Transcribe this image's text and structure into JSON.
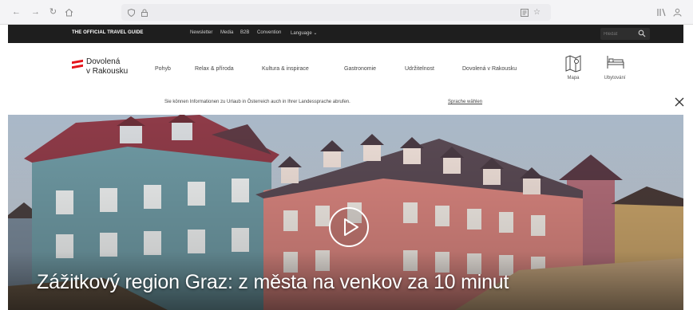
{
  "browser": {
    "back_icon": "back-arrow-icon",
    "forward_icon": "forward-arrow-icon",
    "reload_icon": "reload-icon",
    "home_icon": "home-icon",
    "url": ""
  },
  "top_bar": {
    "guide_label": "THE OFFICIAL TRAVEL GUIDE",
    "links": [
      {
        "label": "Newsletter"
      },
      {
        "label": "Media"
      },
      {
        "label": "B2B"
      },
      {
        "label": "Convention"
      },
      {
        "label": "Language ⌄"
      }
    ],
    "search_placeholder": "Hledat"
  },
  "header": {
    "logo_line1": "Dovolená",
    "logo_line2": "v Rakousku",
    "nav": [
      {
        "label": "Pohyb"
      },
      {
        "label": "Relax & příroda"
      },
      {
        "label": "Kultura & inspirace"
      },
      {
        "label": "Gastronomie"
      },
      {
        "label": "Udržitelnost"
      },
      {
        "label": "Dovolená v Rakousku"
      }
    ],
    "map_label": "Mapa",
    "stay_label": "Ubytování"
  },
  "language_banner": {
    "text": "Sie können Informationen zu Urlaub in Österreich auch in Ihrer Landessprache abrufen.",
    "link": "Sprache wählen"
  },
  "hero": {
    "title": "Zážitkový region Graz: z města na venkov za 10 minut",
    "caption": ""
  },
  "colors": {
    "dark_bar": "#1e1e1e",
    "logo_red": "#e4141b",
    "pink_facade": "#d9857f",
    "teal_facade": "#6f9aa4"
  }
}
